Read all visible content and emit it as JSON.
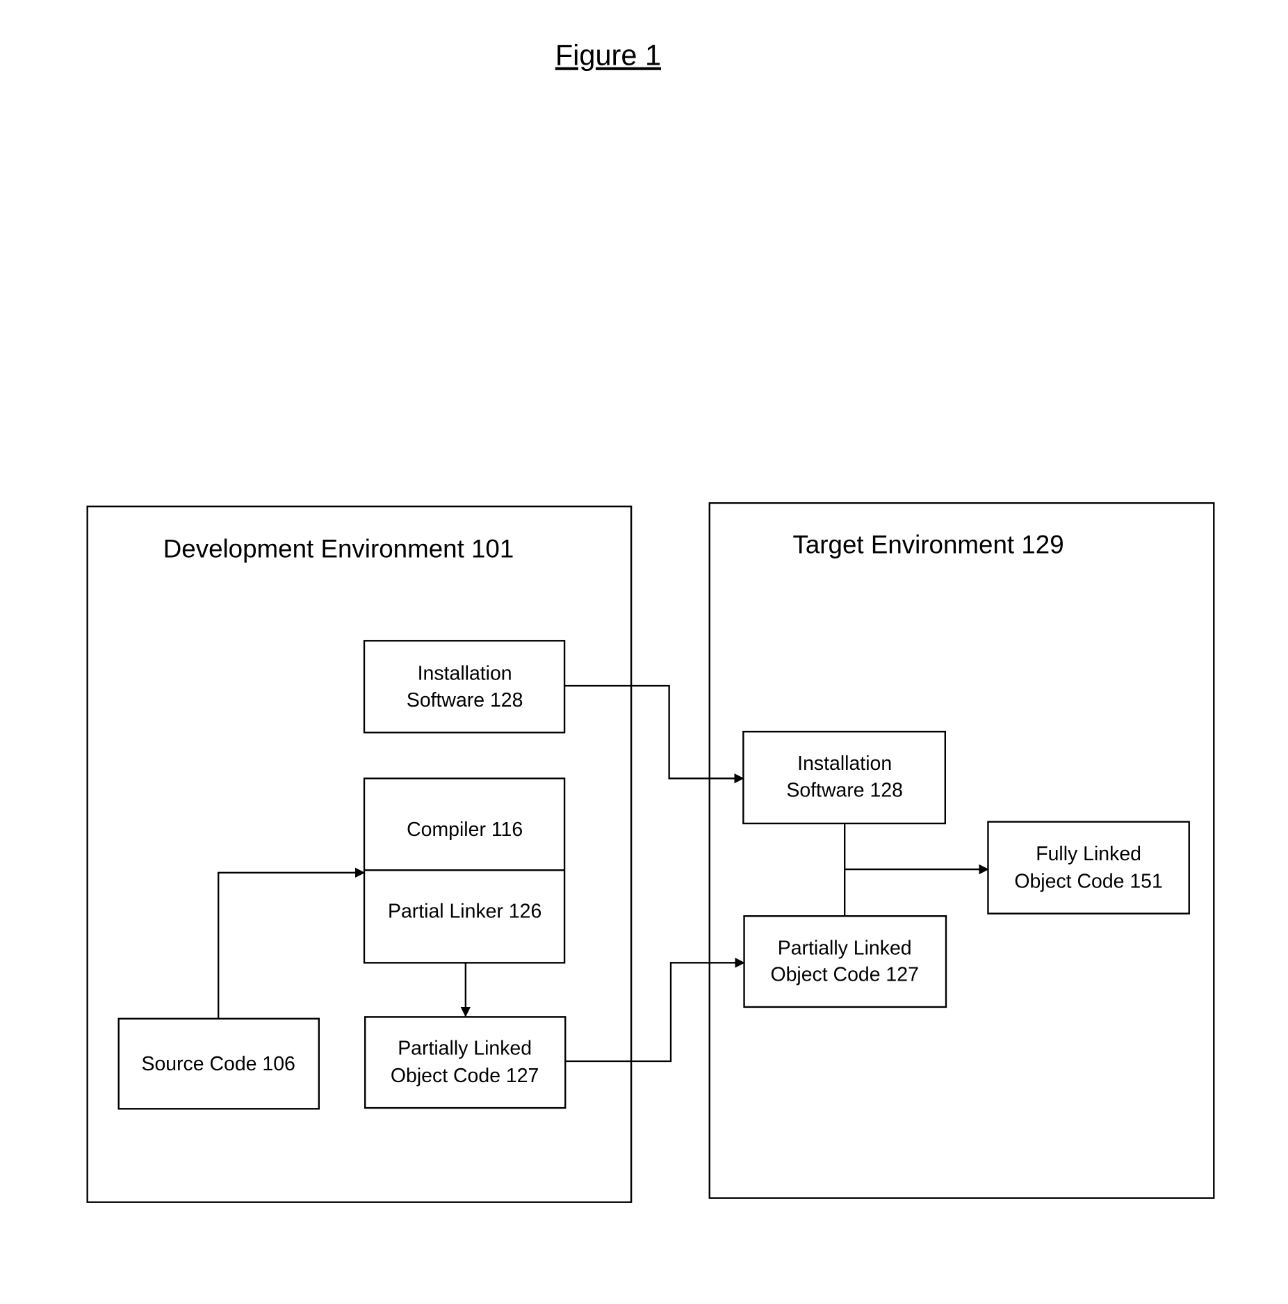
{
  "figure_title": "Figure 1",
  "development_environment": {
    "label": "Development Environment 101",
    "installation_software": [
      "Installation",
      "Software 128"
    ],
    "compiler": "Compiler 116",
    "partial_linker": "Partial Linker 126",
    "source_code": "Source Code 106",
    "partially_linked_object_code": [
      "Partially Linked",
      "Object Code 127"
    ]
  },
  "target_environment": {
    "label": "Target Environment 129",
    "installation_software": [
      "Installation",
      "Software 128"
    ],
    "fully_linked_object_code": [
      "Fully Linked",
      "Object Code 151"
    ],
    "partially_linked_object_code": [
      "Partially Linked",
      "Object Code 127"
    ]
  }
}
